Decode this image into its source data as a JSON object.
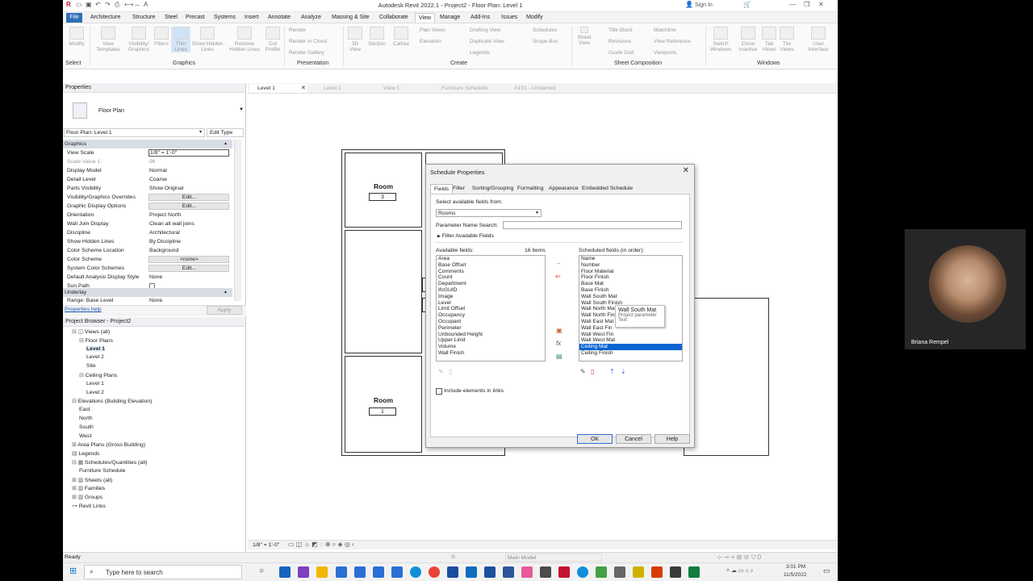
{
  "app": {
    "title": "Autodesk Revit 2022.1 - Project2 - Floor Plan: Level 1",
    "sign_in": "Sign In"
  },
  "ribbon": {
    "tabs": [
      "File",
      "Architecture",
      "Structure",
      "Steel",
      "Precast",
      "Systems",
      "Insert",
      "Annotate",
      "Analyze",
      "Massing & Site",
      "Collaborate",
      "View",
      "Manage",
      "Add-Ins",
      "Issues",
      "Modify"
    ],
    "active_tab": "View",
    "buttons": [
      "Modify",
      "View Templates",
      "Visibility/ Graphics",
      "Filters",
      "Thin Lines",
      "Show Hidden Lines",
      "Remove Hidden Lines",
      "Cut Profile",
      "3D View",
      "Section",
      "Callout",
      "Sheet",
      "View",
      "Switch Windows",
      "Close Inactive",
      "Tab Views",
      "Tile Views",
      "User Interface"
    ],
    "small": [
      "Render",
      "Render in Cloud",
      "Render Gallery",
      "Plan Views",
      "Elevation",
      "Drafting View",
      "Duplicate View",
      "Legends",
      "Schedules",
      "Scope Box",
      "Title Block",
      "Revisions",
      "Guide Grid",
      "Matchline",
      "View Reference",
      "Viewports"
    ],
    "groups": [
      "Select",
      "Graphics",
      "Presentation",
      "Create",
      "Sheet Composition",
      "Windows"
    ]
  },
  "properties": {
    "header": "Properties",
    "type_name": "Floor Plan",
    "selector": "Floor Plan: Level 1",
    "edit_type": "Edit Type",
    "section_graphics": "Graphics",
    "rows": [
      {
        "k": "View Scale",
        "v": "1/8\" = 1'-0\""
      },
      {
        "k": "Scale Value   1:",
        "v": "96"
      },
      {
        "k": "Display Model",
        "v": "Normal"
      },
      {
        "k": "Detail Level",
        "v": "Coarse"
      },
      {
        "k": "Parts Visibility",
        "v": "Show Original"
      },
      {
        "k": "Visibility/Graphics Overrides",
        "v": "Edit..."
      },
      {
        "k": "Graphic Display Options",
        "v": "Edit..."
      },
      {
        "k": "Orientation",
        "v": "Project North"
      },
      {
        "k": "Wall Join Display",
        "v": "Clean all wall joins"
      },
      {
        "k": "Discipline",
        "v": "Architectural"
      },
      {
        "k": "Show Hidden Lines",
        "v": "By Discipline"
      },
      {
        "k": "Color Scheme Location",
        "v": "Background"
      },
      {
        "k": "Color Scheme",
        "v": "<none>"
      },
      {
        "k": "System Color Schemes",
        "v": "Edit..."
      },
      {
        "k": "Default Analysis Display Style",
        "v": "None"
      },
      {
        "k": "Sun Path",
        "v": ""
      }
    ],
    "section_underlay": "Underlay",
    "range_row": {
      "k": "Range: Base Level",
      "v": "None"
    },
    "help": "Properties help",
    "apply": "Apply"
  },
  "browser": {
    "header": "Project Browser - Project2",
    "items": [
      "Views (all)",
      "Floor Plans",
      "Level 1",
      "Level 2",
      "Site",
      "Ceiling Plans",
      "Level 1",
      "Level 2",
      "Elevations (Building Elevation)",
      "East",
      "North",
      "South",
      "West",
      "Area Plans (Gross Building)",
      "Legends",
      "Schedules/Quantities (all)",
      "Furniture Schedule",
      "Sheets (all)",
      "Families",
      "Groups",
      "Revit Links"
    ]
  },
  "view_tabs": [
    "Level 1",
    "Level 1",
    "View 1",
    "Furniture Schedule",
    "A101 - Unnamed"
  ],
  "canvas": {
    "room_label": "Room",
    "room_num_top": "3",
    "room_num_bottom": "1"
  },
  "view_control": {
    "scale": "1/8\" = 1'-0\""
  },
  "status": {
    "ready": "Ready",
    "count": ":0",
    "model": "Main Model"
  },
  "dialog": {
    "title": "Schedule Properties",
    "tabs": [
      "Fields",
      "Filter",
      "Sorting/Grouping",
      "Formatting",
      "Appearance",
      "Embedded Schedule"
    ],
    "select_from_label": "Select available fields from:",
    "select_from_value": "Rooms",
    "param_search_label": "Parameter Name Search:",
    "filter_available": "Filter Available Fields",
    "available_label": "Available fields:",
    "available_count": "16 items",
    "available": [
      "Area",
      "Base Offset",
      "Comments",
      "Count",
      "Department",
      "IfcGUID",
      "Image",
      "Level",
      "Limit Offset",
      "Occupancy",
      "Occupant",
      "Perimeter",
      "Unbounded Height",
      "Upper Limit",
      "Volume",
      "Wall Finish"
    ],
    "scheduled_label": "Scheduled fields (in order):",
    "scheduled": [
      "Name",
      "Number",
      "Floor Material",
      "Floor Finish",
      "Base Mat",
      "Base Finish",
      "Wall South Mat",
      "Wall South Finish",
      "Wall North Mat",
      "Wall North Finish",
      "Wall East Mat",
      "Wall East Fin",
      "Wall West Fin",
      "Wall West Mat",
      "Ceiling Mat",
      "Ceiling Finish"
    ],
    "selected_scheduled": "Ceiling Mat",
    "tooltip": {
      "title": "Wall South Mat",
      "line1": "Project parameter",
      "line2": "Text"
    },
    "include_links": "Include elements in links",
    "ok": "OK",
    "cancel": "Cancel",
    "help": "Help"
  },
  "webcam": {
    "name": "Briana Rempel"
  },
  "taskbar": {
    "search_placeholder": "Type here to search",
    "time": "3:01 PM",
    "date": "11/5/2022"
  }
}
